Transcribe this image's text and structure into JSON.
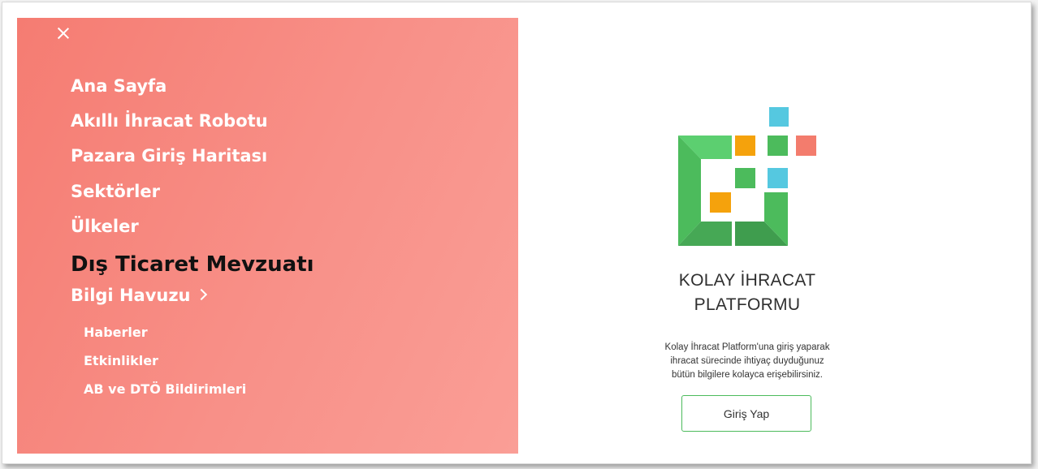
{
  "menu": {
    "items": [
      {
        "label": "Ana Sayfa"
      },
      {
        "label": "Akıllı İhracat Robotu"
      },
      {
        "label": "Pazara Giriş Haritası"
      },
      {
        "label": "Sektörler"
      },
      {
        "label": "Ülkeler"
      },
      {
        "label": "Dış Ticaret Mevzuatı"
      },
      {
        "label": "Bilgi Havuzu"
      }
    ],
    "sub_items": [
      {
        "label": "Haberler"
      },
      {
        "label": "Etkinlikler"
      },
      {
        "label": "AB ve DTÖ Bildirimleri"
      }
    ]
  },
  "brand": {
    "line1": "KOLAY İHRACAT",
    "line2": "PLATFORMU",
    "description_line1": "Kolay İhracat Platform'una giriş yaparak",
    "description_line2": "ihracat sürecinde ihtiyaç duyduğunuz",
    "description_line3": "bütün bilgilere kolayca erişebilirsiniz."
  },
  "login_button": {
    "label": "Giriş Yap"
  },
  "colors": {
    "menu_bg": "#f7877e",
    "accent_green": "#4cbb5c",
    "logo_orange": "#f5a20c",
    "logo_blue": "#55c8e0",
    "logo_red": "#f37c6d"
  },
  "icons": {
    "close": "close-icon",
    "chevron": "chevron-right-icon",
    "logo": "kolay-ihracat-logo"
  }
}
